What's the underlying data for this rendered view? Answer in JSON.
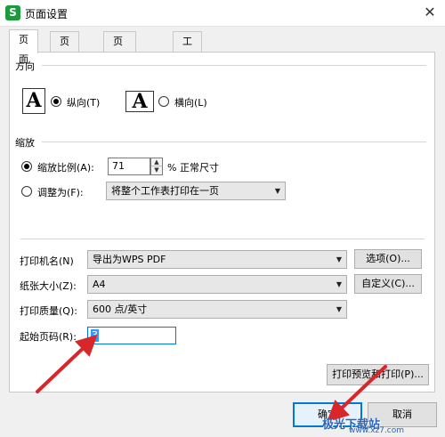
{
  "window": {
    "title": "页面设置",
    "app_icon_letter": "S",
    "close_glyph": "✕"
  },
  "tabs": [
    {
      "label": "页面"
    },
    {
      "label": "页边距"
    },
    {
      "label": "页眉/页脚"
    },
    {
      "label": "工作表"
    }
  ],
  "orientation": {
    "heading": "方向",
    "icon_letter": "A",
    "portrait_label": "纵向(T)",
    "landscape_label": "横向(L)",
    "selected": "portrait"
  },
  "scaling": {
    "heading": "缩放",
    "scale_label": "缩放比例(A):",
    "scale_value": "71",
    "scale_suffix": "% 正常尺寸",
    "fit_label": "调整为(F):",
    "fit_option": "将整个工作表打印在一页",
    "selected": "scale"
  },
  "printer": {
    "name_label": "打印机名(N)",
    "name_value": "导出为WPS PDF",
    "options_button": "选项(O)...",
    "paper_label": "纸张大小(Z):",
    "paper_value": "A4",
    "custom_button": "自定义(C)...",
    "quality_label": "打印质量(Q):",
    "quality_value": "600 点/英寸",
    "start_label": "起始页码(R):",
    "start_value": "3"
  },
  "buttons": {
    "preview_print": "打印预览和打印(P)...",
    "ok": "确定",
    "cancel": "取消"
  },
  "watermark": {
    "text": "极光下载站",
    "url": "www.xz7.com"
  },
  "colors": {
    "accent": "#0078d7",
    "annotation_arrow": "#d9262b",
    "selection": "#3399ff"
  }
}
